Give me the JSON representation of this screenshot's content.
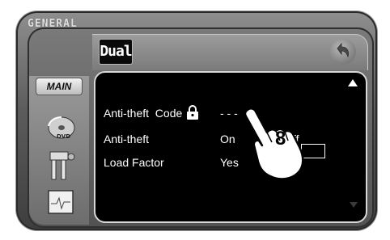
{
  "header": {
    "section_title": "GENERAL",
    "logo_text": "Dual"
  },
  "sidebar": {
    "main_label": "MAIN",
    "items": [
      {
        "icon": "dvd-icon"
      },
      {
        "icon": "tools-icon"
      },
      {
        "icon": "monitor-icon"
      }
    ]
  },
  "settings": {
    "rows": [
      {
        "label": "Anti-theft  Code",
        "value": "- - -"
      },
      {
        "label": "Anti-theft",
        "value": "On",
        "alt_value": "ff"
      },
      {
        "label": "Load Factor",
        "value": "Yes"
      }
    ]
  },
  "callout": {
    "step_number": "8"
  }
}
